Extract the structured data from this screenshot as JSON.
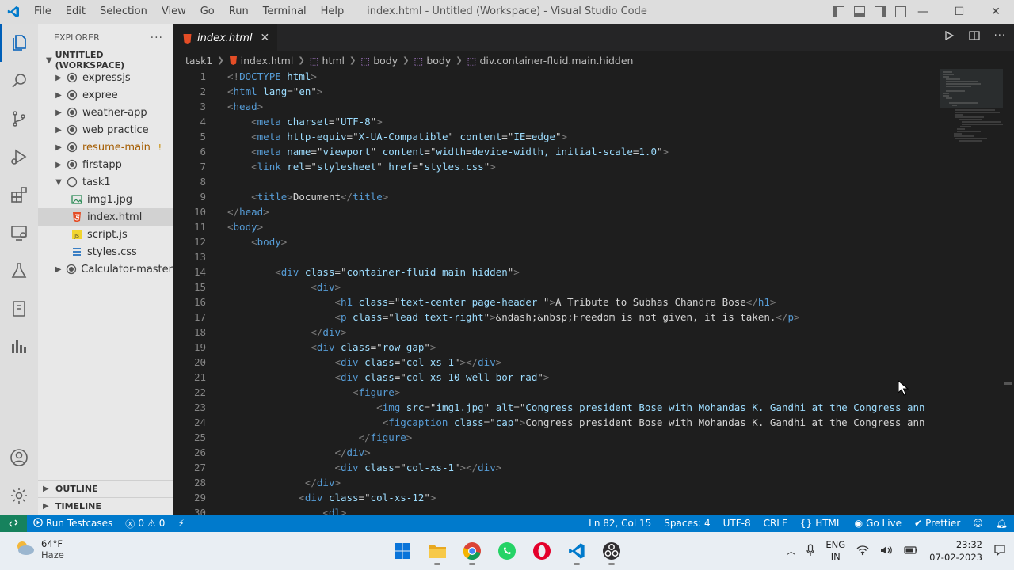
{
  "titlebar": {
    "menu": [
      "File",
      "Edit",
      "Selection",
      "View",
      "Go",
      "Run",
      "Terminal",
      "Help"
    ],
    "window_title": "index.html - Untitled (Workspace) - Visual Studio Code"
  },
  "sidebar": {
    "header": "EXPLORER",
    "more": "···",
    "workspace": "UNTITLED (WORKSPACE)",
    "items": [
      {
        "label": "expressjs"
      },
      {
        "label": "expree"
      },
      {
        "label": "weather-app"
      },
      {
        "label": "web practice"
      },
      {
        "label": "resume-main",
        "badge": "!"
      },
      {
        "label": "firstapp"
      },
      {
        "label": "task1"
      },
      {
        "label": "img1.jpg"
      },
      {
        "label": "index.html"
      },
      {
        "label": "script.js"
      },
      {
        "label": "styles.css"
      },
      {
        "label": "Calculator-master"
      }
    ],
    "outline": "OUTLINE",
    "timeline": "TIMELINE"
  },
  "editor": {
    "tab_label": "index.html",
    "breadcrumbs": [
      "task1",
      "index.html",
      "html",
      "body",
      "body",
      "div.container-fluid.main.hidden"
    ],
    "line_numbers": [
      "1",
      "2",
      "3",
      "4",
      "5",
      "6",
      "7",
      "8",
      "9",
      "10",
      "11",
      "12",
      "13",
      "14",
      "15",
      "16",
      "17",
      "18",
      "19",
      "20",
      "21",
      "22",
      "23",
      "24",
      "25",
      "26",
      "27",
      "28",
      "29",
      "30"
    ],
    "code_lines": [
      "<!DOCTYPE html>",
      "<html lang=\"en\">",
      "<head>",
      "    <meta charset=\"UTF-8\">",
      "    <meta http-equiv=\"X-UA-Compatible\" content=\"IE=edge\">",
      "    <meta name=\"viewport\" content=\"width=device-width, initial-scale=1.0\">",
      "    <link rel=\"stylesheet\" href=\"styles.css\">",
      "",
      "    <title>Document</title>",
      "</head>",
      "<body>",
      "    <body>",
      "",
      "        <div class=\"container-fluid main hidden\">",
      "              <div>",
      "                  <h1 class=\"text-center page-header \">A Tribute to Subhas Chandra Bose</h1>",
      "                  <p class=\"lead text-right\">&ndash;&nbsp;Freedom is not given, it is taken.</p>",
      "              </div>",
      "              <div class=\"row gap\">",
      "                  <div class=\"col-xs-1\"></div>",
      "                  <div class=\"col-xs-10 well bor-rad\">",
      "                     <figure>",
      "                         <img src=\"img1.jpg\" alt=\"Congress president Bose with Mohandas K. Gandhi at the Congress ann",
      "                          <figcaption class=\"cap\">Congress president Bose with Mohandas K. Gandhi at the Congress ann",
      "                      </figure>",
      "                  </div>",
      "                  <div class=\"col-xs-1\"></div>",
      "             </div>",
      "            <div class=\"col-xs-12\">",
      "                <dl>"
    ]
  },
  "statusbar": {
    "run_testcases": "Run Testcases",
    "errors": "0",
    "warnings": "0",
    "position": "Ln 82, Col 15",
    "spaces": "Spaces: 4",
    "encoding": "UTF-8",
    "eol": "CRLF",
    "language": "HTML",
    "go_live": "Go Live",
    "prettier": "Prettier"
  },
  "taskbar": {
    "temperature": "64°F",
    "condition": "Haze",
    "lang_top": "ENG",
    "lang_bottom": "IN",
    "time": "23:32",
    "date": "07-02-2023"
  }
}
